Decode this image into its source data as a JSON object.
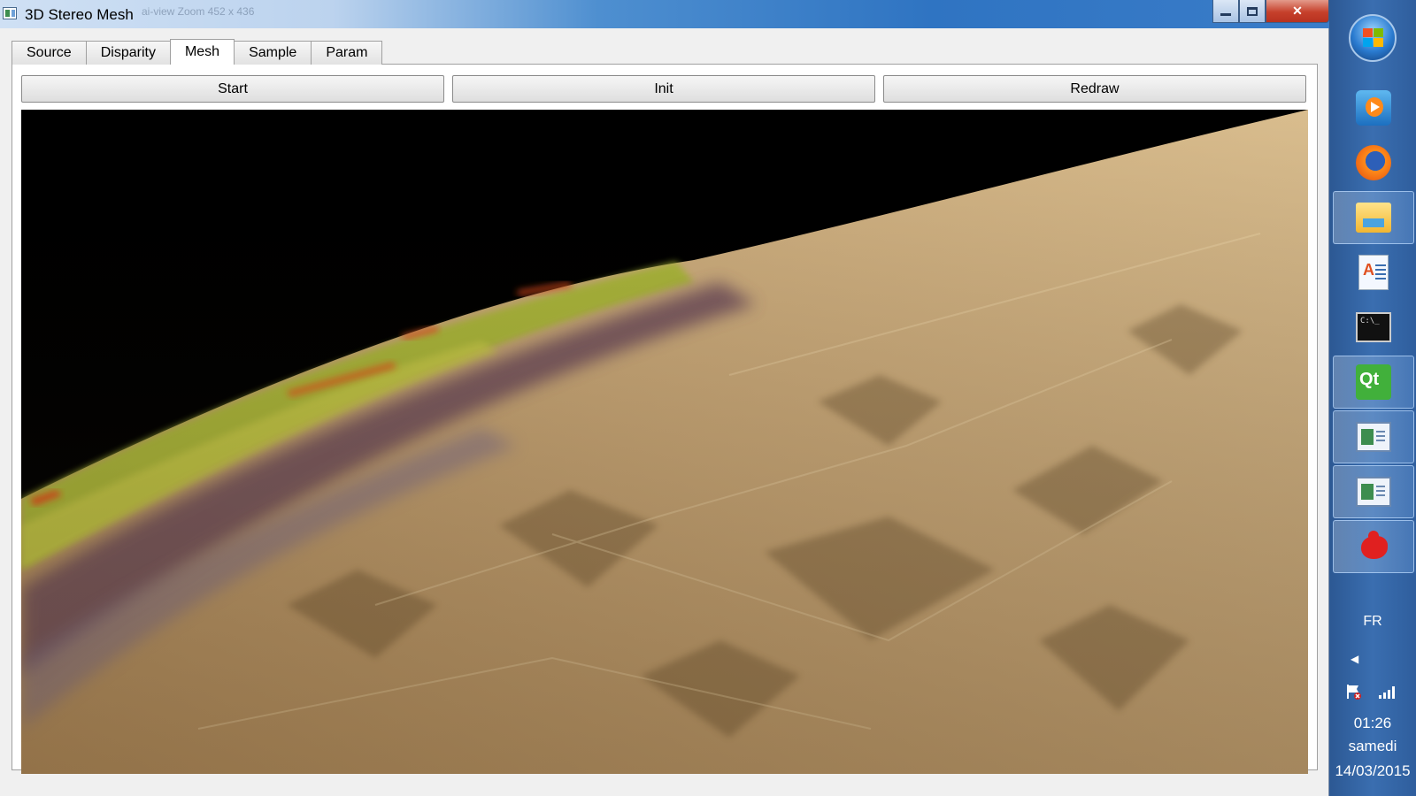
{
  "window": {
    "title": "3D Stereo Mesh",
    "ghost_title": "ai-view Zoom 452 x 436",
    "minimize_icon": "minimize-icon",
    "maximize_icon": "restore-icon",
    "close_symbol": "✕"
  },
  "tabs": [
    {
      "label": "Source"
    },
    {
      "label": "Disparity"
    },
    {
      "label": "Mesh",
      "active": true
    },
    {
      "label": "Sample"
    },
    {
      "label": "Param"
    }
  ],
  "buttons": {
    "start": "Start",
    "init": "Init",
    "redraw": "Redraw"
  },
  "taskbar": {
    "apps": [
      {
        "icon": "media-player-icon"
      },
      {
        "icon": "firefox-icon"
      },
      {
        "icon": "file-explorer-icon"
      },
      {
        "icon": "wordpad-icon"
      },
      {
        "icon": "command-prompt-icon"
      },
      {
        "icon": "qt-creator-icon"
      },
      {
        "icon": "app-window-icon"
      },
      {
        "icon": "app-window-icon"
      },
      {
        "icon": "gnome-splash-icon"
      }
    ],
    "tray": {
      "language": "FR",
      "time": "01:26",
      "day": "samedi",
      "date": "14/03/2015"
    }
  }
}
